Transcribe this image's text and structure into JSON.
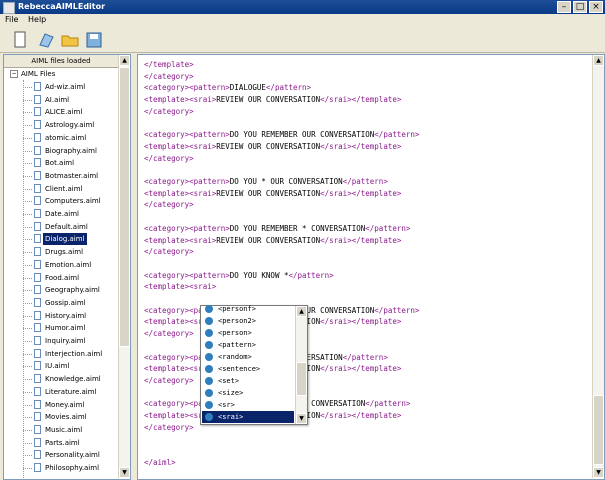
{
  "window": {
    "title": "RebeccaAIMLEditor"
  },
  "menu": [
    "File",
    "Help"
  ],
  "toolbar": [
    "new-icon",
    "open-icon",
    "folder-icon",
    "save-icon"
  ],
  "leftpane": {
    "header": "AIML files loaded",
    "root": "AIML Files",
    "items": [
      "Ad-wiz.aiml",
      "AI.aiml",
      "ALICE.aiml",
      "Astrology.aiml",
      "atomic.aiml",
      "Biography.aiml",
      "Bot.aiml",
      "Botmaster.aiml",
      "Client.aiml",
      "Computers.aiml",
      "Date.aiml",
      "Default.aiml",
      "Dialog.aiml",
      "Drugs.aiml",
      "Emotion.aiml",
      "Food.aiml",
      "Geography.aiml",
      "Gossip.aiml",
      "History.aiml",
      "Humor.aiml",
      "Inquiry.aiml",
      "Interjection.aiml",
      "IU.aiml",
      "Knowledge.aiml",
      "Literature.aiml",
      "Money.aiml",
      "Movies.aiml",
      "Music.aiml",
      "Parts.aiml",
      "Personality.aiml",
      "Philosophy.aiml"
    ],
    "selected_index": 12
  },
  "editor": {
    "lines": [
      [
        [
          "tag",
          "</template>"
        ]
      ],
      [
        [
          "tag",
          "</category>"
        ]
      ],
      [
        [
          "tag",
          "<category><pattern>"
        ],
        [
          "txt",
          "DIALOGUE"
        ],
        [
          "tag",
          "</pattern>"
        ]
      ],
      [
        [
          "tag",
          "<template><srai>"
        ],
        [
          "txt",
          "REVIEW OUR CONVERSATION"
        ],
        [
          "tag",
          "</srai></template>"
        ]
      ],
      [
        [
          "tag",
          "</category>"
        ]
      ],
      [],
      [
        [
          "tag",
          "<category><pattern>"
        ],
        [
          "txt",
          "DO YOU REMEMBER OUR CONVERSATION"
        ],
        [
          "tag",
          "</pattern>"
        ]
      ],
      [
        [
          "tag",
          "<template><srai>"
        ],
        [
          "txt",
          "REVIEW OUR CONVERSATION"
        ],
        [
          "tag",
          "</srai></template>"
        ]
      ],
      [
        [
          "tag",
          "</category>"
        ]
      ],
      [],
      [
        [
          "tag",
          "<category><pattern>"
        ],
        [
          "txt",
          "DO YOU * OUR CONVERSATION"
        ],
        [
          "tag",
          "</pattern>"
        ]
      ],
      [
        [
          "tag",
          "<template><srai>"
        ],
        [
          "txt",
          "REVIEW OUR CONVERSATION"
        ],
        [
          "tag",
          "</srai></template>"
        ]
      ],
      [
        [
          "tag",
          "</category>"
        ]
      ],
      [],
      [
        [
          "tag",
          "<category><pattern>"
        ],
        [
          "txt",
          "DO YOU REMEMBER * CONVERSATION"
        ],
        [
          "tag",
          "</pattern>"
        ]
      ],
      [
        [
          "tag",
          "<template><srai>"
        ],
        [
          "txt",
          "REVIEW OUR CONVERSATION"
        ],
        [
          "tag",
          "</srai></template>"
        ]
      ],
      [
        [
          "tag",
          "</category>"
        ]
      ],
      [],
      [
        [
          "tag",
          "<category><pattern>"
        ],
        [
          "txt",
          "DO YOU KNOW *"
        ],
        [
          "tag",
          "</pattern>"
        ]
      ],
      [
        [
          "tag",
          "<template><srai>"
        ]
      ],
      [],
      [
        [
          "tag",
          "<category><pattern>"
        ],
        [
          "txt",
          "DO YOU REMEMBER OUR CONVERSATION"
        ],
        [
          "tag",
          "</pattern>"
        ]
      ],
      [
        [
          "tag",
          "<template><srai>"
        ],
        [
          "txt",
          "REVIEW OUR CONVERSATION"
        ],
        [
          "tag",
          "</srai></template>"
        ]
      ],
      [
        [
          "tag",
          "</category>"
        ]
      ],
      [],
      [
        [
          "tag",
          "<category><pattern>"
        ],
        [
          "txt",
          "DO YOU * OUR CONVERSATION"
        ],
        [
          "tag",
          "</pattern>"
        ]
      ],
      [
        [
          "tag",
          "<template><srai>"
        ],
        [
          "txt",
          "REVIEW OUR CONVERSATION"
        ],
        [
          "tag",
          "</srai></template>"
        ]
      ],
      [
        [
          "tag",
          "</category>"
        ]
      ],
      [],
      [
        [
          "tag",
          "<category><pattern>"
        ],
        [
          "txt",
          "DO YOU REMEMBER * CONVERSATION"
        ],
        [
          "tag",
          "</pattern>"
        ]
      ],
      [
        [
          "tag",
          "<template><srai>"
        ],
        [
          "txt",
          "REVIEW OUR CONVERSATION"
        ],
        [
          "tag",
          "</srai></template>"
        ]
      ],
      [
        [
          "tag",
          "</category>"
        ]
      ],
      [],
      [],
      [
        [
          "tag",
          "</aiml>"
        ]
      ]
    ]
  },
  "autocomplete": {
    "items": [
      "<personf>",
      "<person2>",
      "<person>",
      "<pattern>",
      "<random>",
      "<sentence>",
      "<set>",
      "<size>",
      "<sr>",
      "<srai>"
    ],
    "selected_index": 9
  }
}
